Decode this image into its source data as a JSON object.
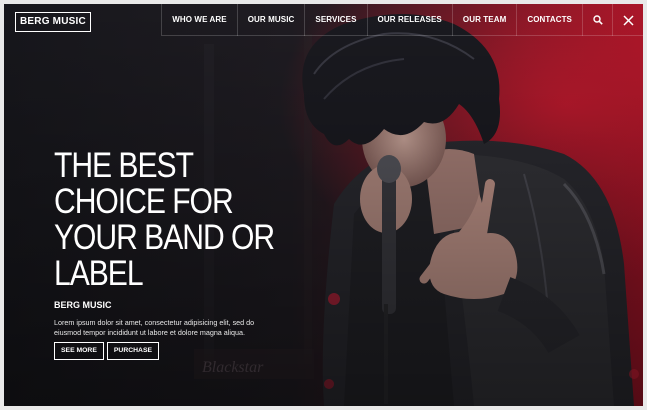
{
  "logo": "BERG MUSIC",
  "nav": {
    "items": [
      {
        "label": "WHO WE ARE",
        "name": "nav-who-we-are"
      },
      {
        "label": "OUR MUSIC",
        "name": "nav-our-music"
      },
      {
        "label": "SERVICES",
        "name": "nav-services"
      },
      {
        "label": "OUR RELEASES",
        "name": "nav-our-releases"
      },
      {
        "label": "OUR TEAM",
        "name": "nav-our-team"
      },
      {
        "label": "CONTACTS",
        "name": "nav-contacts"
      }
    ],
    "search_icon": "search-icon",
    "close_icon": "close-icon"
  },
  "hero": {
    "title_lines": [
      "THE BEST",
      "CHOICE FOR",
      "YOUR BAND OR",
      "LABEL"
    ],
    "subtitle": "BERG MUSIC",
    "description": "Lorem ipsum dolor sit amet, consectetur adipisicing elit, sed do eiusmod tempor incididunt ut labore et dolore magna aliqua.",
    "buttons": {
      "see_more": "SEE MORE",
      "purchase": "PURCHASE"
    },
    "amp_brand": "Blackstar"
  },
  "colors": {
    "background_dark": "#1b1b20",
    "stage_red": "#b0182a",
    "text": "#ffffff"
  }
}
